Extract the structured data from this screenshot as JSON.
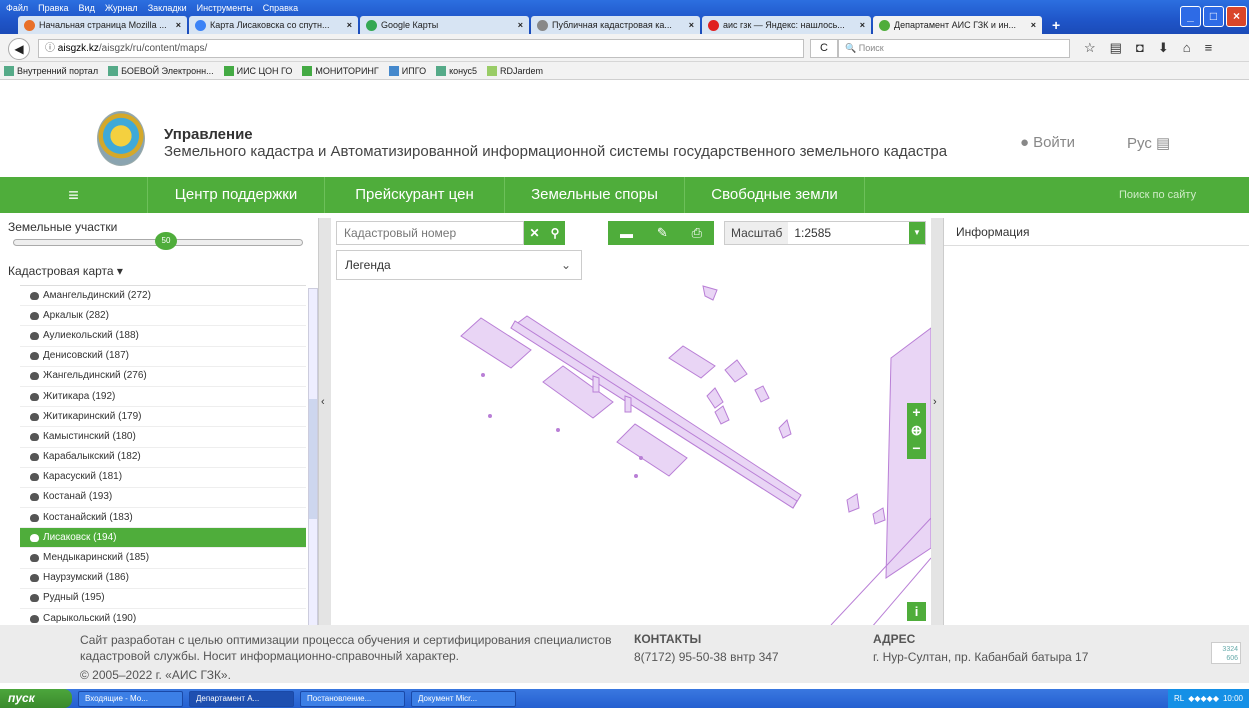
{
  "browser": {
    "menu": [
      "Файл",
      "Правка",
      "Вид",
      "Журнал",
      "Закладки",
      "Инструменты",
      "Справка"
    ],
    "tabs": [
      {
        "label": "Начальная страница Mozilla ...",
        "icon": "firefox-icon",
        "color": "#e8702a",
        "active": false
      },
      {
        "label": "Карта Лисаковска со спутн...",
        "icon": "map-app-icon",
        "color": "#3b82f6",
        "active": false
      },
      {
        "label": "Google Карты",
        "icon": "google-maps-icon",
        "color": "#34a853",
        "active": false
      },
      {
        "label": "Публичная кадастровая ка...",
        "icon": "cadastre-icon",
        "color": "#888888",
        "active": false
      },
      {
        "label": "аис гзк — Яндекс: нашлось...",
        "icon": "yandex-icon",
        "color": "#e02020",
        "active": false
      },
      {
        "label": "Департамент АИС ГЗК и ин...",
        "icon": "site-icon",
        "color": "#4fad3b",
        "active": true
      }
    ],
    "close_glyph": "×",
    "newtab_glyph": "+",
    "url_domain": "aisgzk.kz",
    "url_path": "/aisgzk/ru/content/maps/",
    "reload_glyph": "C",
    "search_placeholder": "Поиск",
    "bookmarks": [
      "Внутренний портал",
      "БОЕВОЙ Электронн...",
      "ИИС ЦОН ГО",
      "МОНИТОРИНГ",
      "ИПГО",
      "конус5",
      "RDJardem"
    ]
  },
  "site": {
    "org_title": "Управление",
    "org_subtitle": "Земельного кадастра и Автоматизированной информационной системы государственного земельного кадастра",
    "login": "Войти",
    "lang": "Рус",
    "nav": [
      "Центр поддержки",
      "Прейскурант цен",
      "Земельные споры",
      "Свободные земли"
    ],
    "search_placeholder": "Поиск по сайту"
  },
  "left": {
    "parcels_label": "Земельные участки",
    "slider_value": "50",
    "map_select": "Кадастровая карта ▾",
    "districts": [
      {
        "label": "Амангельдинский (272)",
        "selected": false
      },
      {
        "label": "Аркалык (282)",
        "selected": false
      },
      {
        "label": "Аулиекольский (188)",
        "selected": false
      },
      {
        "label": "Денисовский (187)",
        "selected": false
      },
      {
        "label": "Жангельдинский (276)",
        "selected": false
      },
      {
        "label": "Житикара (192)",
        "selected": false
      },
      {
        "label": "Житикаринский (179)",
        "selected": false
      },
      {
        "label": "Камыстинский (180)",
        "selected": false
      },
      {
        "label": "Карабалыкский (182)",
        "selected": false
      },
      {
        "label": "Карасуский (181)",
        "selected": false
      },
      {
        "label": "Костанай (193)",
        "selected": false
      },
      {
        "label": "Костанайский (183)",
        "selected": false
      },
      {
        "label": "Лисаковск (194)",
        "selected": true
      },
      {
        "label": "Мендыкаринский (185)",
        "selected": false
      },
      {
        "label": "Наурзумский (186)",
        "selected": false
      },
      {
        "label": "Рудный (195)",
        "selected": false
      },
      {
        "label": "Сарыкольский (190)",
        "selected": false
      }
    ]
  },
  "map": {
    "cadastral_placeholder": "Кадастровый номер",
    "scale_label": "Масштаб",
    "scale_value": "1:2585",
    "legend_label": "Легенда",
    "parcel_color": "#e9d5f5",
    "parcel_stroke": "#b97fd6"
  },
  "right": {
    "info_title": "Информация"
  },
  "footer": {
    "about": "Сайт разработан с целью оптимизации процесса обучения и сертифицирования специалистов кадастровой службы. Носит информационно-справочный характер.",
    "copyright": "© 2005–2022 г. «АИС ГЗК».",
    "contacts_title": "КОНТАКТЫ",
    "contacts_phone": "8(7172) 95-50-38 внтр 347",
    "address_title": "АДРЕС",
    "address": "г. Нур-Султан, пр. Кабанбай батыра 17",
    "counter_top": "3324",
    "counter_bottom": "606"
  },
  "taskbar": {
    "start": "пуск",
    "tasks": [
      "Входящие - Мо...",
      "Департамент А...",
      "Постановление...",
      "Документ Micr..."
    ],
    "tray_lang": "RL",
    "clock": "10:00"
  },
  "colors": {
    "accent": "#4fad3b",
    "winxp_blue": "#245fd0"
  }
}
